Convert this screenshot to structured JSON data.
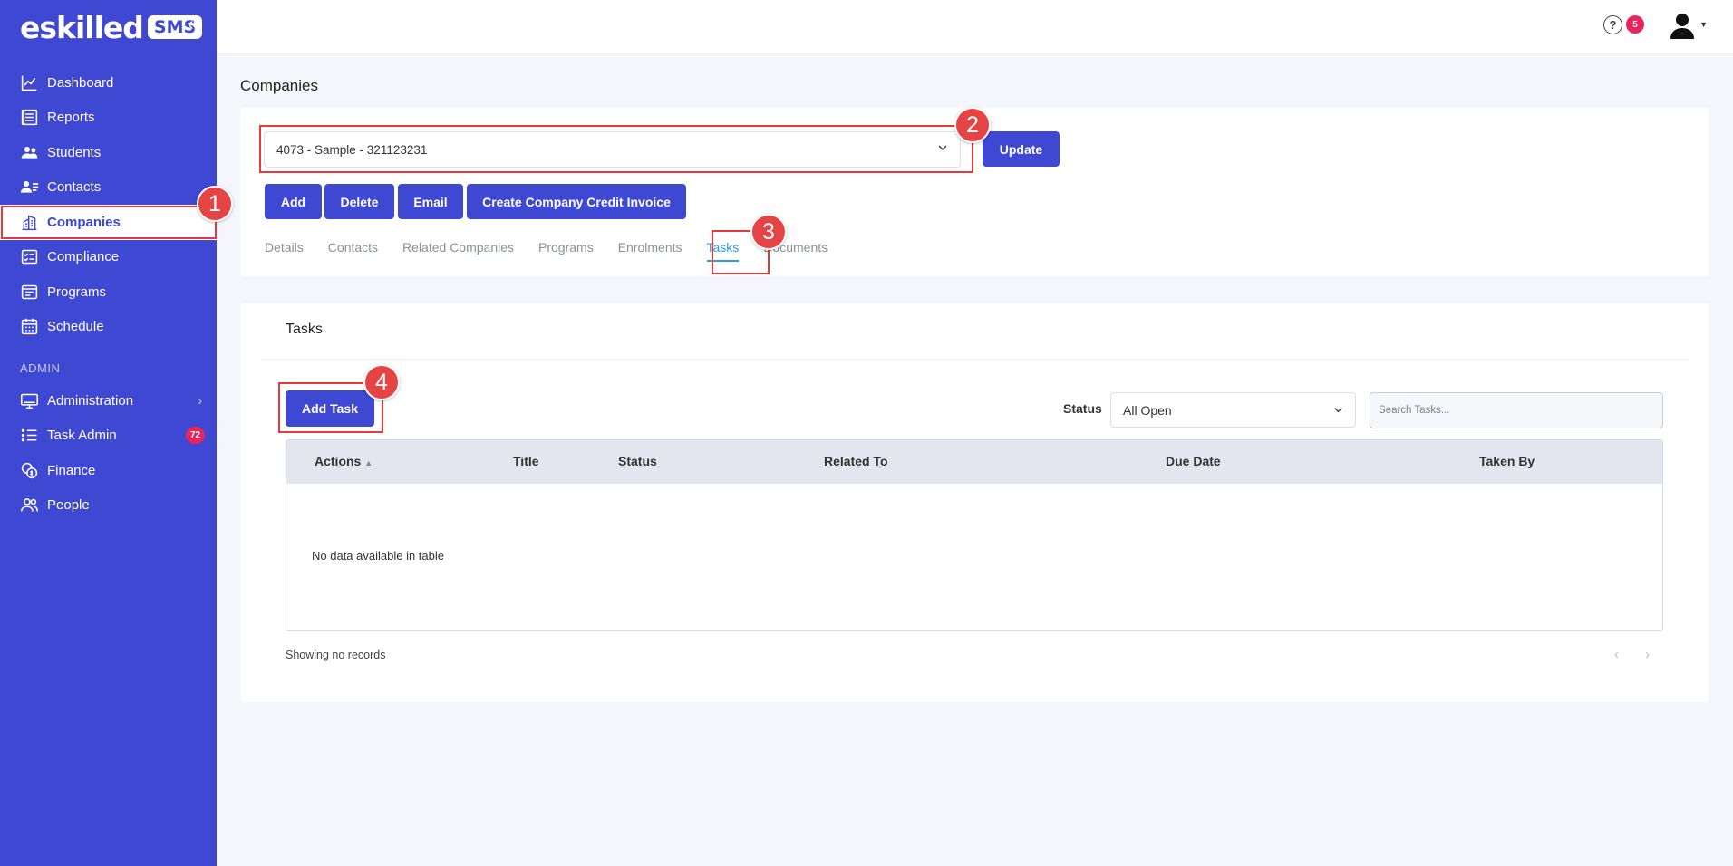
{
  "brand": {
    "logo_text": "eskilled",
    "logo_badge": "SMS"
  },
  "sidebar": {
    "items": [
      {
        "label": "Dashboard",
        "icon": "chart-line-icon"
      },
      {
        "label": "Reports",
        "icon": "report-icon"
      },
      {
        "label": "Students",
        "icon": "students-icon"
      },
      {
        "label": "Contacts",
        "icon": "contacts-icon"
      },
      {
        "label": "Companies",
        "icon": "building-icon",
        "active": true
      },
      {
        "label": "Compliance",
        "icon": "compliance-icon"
      },
      {
        "label": "Programs",
        "icon": "programs-icon"
      },
      {
        "label": "Schedule",
        "icon": "calendar-icon"
      }
    ],
    "section_admin": "ADMIN",
    "admin_items": [
      {
        "label": "Administration",
        "icon": "monitor-icon"
      },
      {
        "label": "Task Admin",
        "icon": "list-icon",
        "badge": "72"
      },
      {
        "label": "Finance",
        "icon": "coins-icon"
      },
      {
        "label": "People",
        "icon": "people-icon"
      }
    ]
  },
  "topbar": {
    "notification_count": "5"
  },
  "page": {
    "title": "Companies",
    "company_select_value": "4073 - Sample - 321123231",
    "update_label": "Update",
    "actions": [
      "Add",
      "Delete",
      "Email",
      "Create Company Credit Invoice"
    ],
    "tabs": [
      "Details",
      "Contacts",
      "Related Companies",
      "Programs",
      "Enrolments",
      "Tasks",
      "Documents"
    ],
    "active_tab": "Tasks"
  },
  "tasks": {
    "title": "Tasks",
    "add_label": "Add Task",
    "status_label": "Status",
    "status_value": "All Open",
    "search_placeholder": "Search Tasks...",
    "columns": [
      "Actions",
      "Title",
      "Status",
      "Related To",
      "Due Date",
      "Taken By"
    ],
    "empty_text": "No data available in table",
    "records_text": "Showing no records",
    "prev_glyph": "‹",
    "next_glyph": "›"
  },
  "annotations": [
    "1",
    "2",
    "3",
    "4"
  ],
  "colors": {
    "primary": "#3f48d2",
    "highlight": "#e23b3b",
    "badge": "#e8245c",
    "tab_active": "#2d9cdb"
  }
}
